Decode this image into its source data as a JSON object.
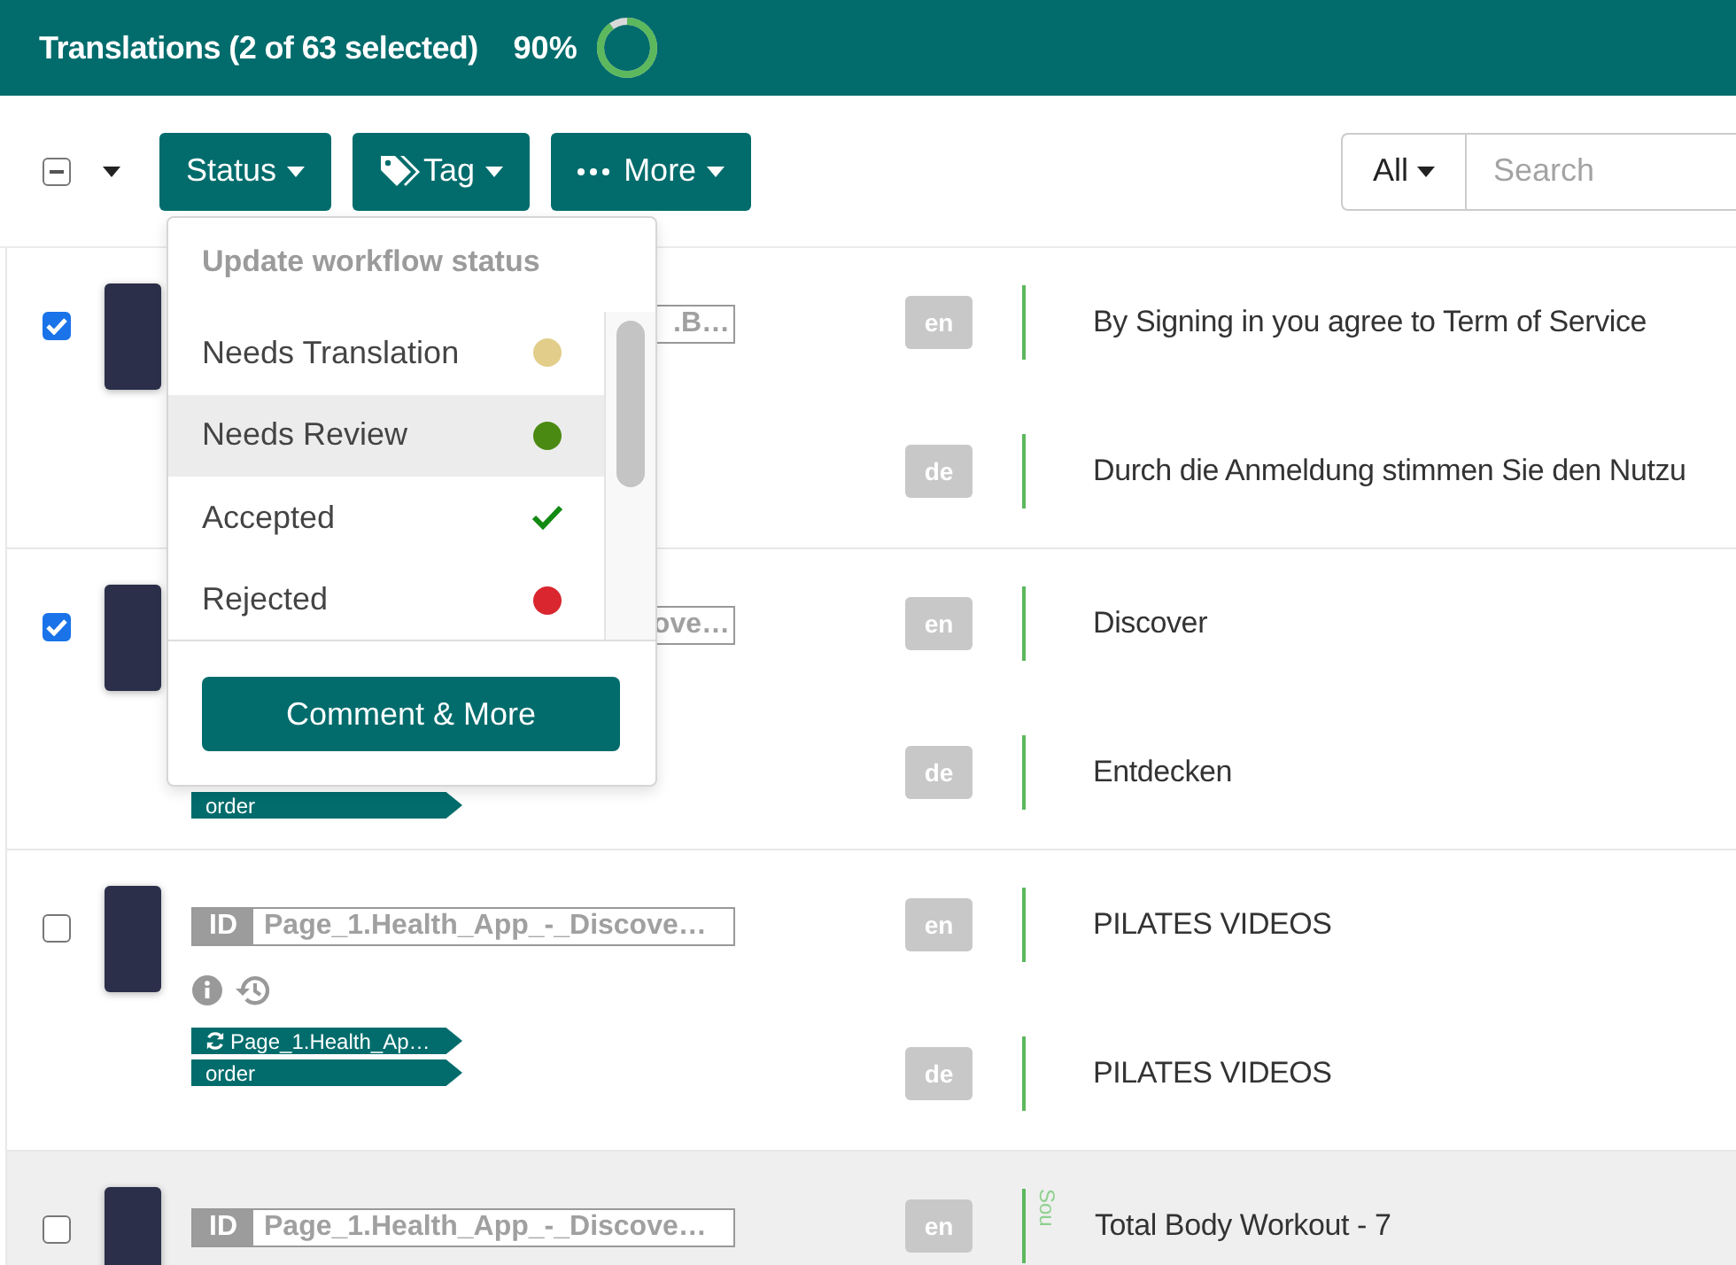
{
  "header": {
    "title": "Translations (2 of 63 selected)",
    "percent": "90%",
    "progress": {
      "level": 0.9
    }
  },
  "toolbar": {
    "select_all": {
      "indeterminate": true
    },
    "buttons": [
      {
        "label": "Status",
        "kind": "plain"
      },
      {
        "label": "Tag",
        "kind": "tag"
      },
      {
        "label": "More",
        "kind": "dots"
      }
    ],
    "scope": "All",
    "search": {
      "placeholder": "Search"
    }
  },
  "status_menu": {
    "title": "Update workflow status",
    "items": [
      {
        "label": "Needs Translation",
        "kind": "dot",
        "color": "#e2cd8a",
        "highlighted": false
      },
      {
        "label": "Needs Review",
        "kind": "dot",
        "color": "#4b8a12",
        "highlighted": true
      },
      {
        "label": "Accepted",
        "kind": "check",
        "highlighted": false
      },
      {
        "label": "Rejected",
        "kind": "dot",
        "color": "#d9262f",
        "highlighted": false
      }
    ],
    "action": "Comment & More"
  },
  "rows": [
    {
      "checked": true,
      "hovered": false,
      "id_text": ".B…",
      "tags": [],
      "icons": false,
      "translations": [
        {
          "lang": "en",
          "text": "By Signing in you agree to Term of Service"
        },
        {
          "lang": "de",
          "text": "Durch die Anmeldung stimmen Sie den Nutzu"
        }
      ]
    },
    {
      "checked": true,
      "hovered": false,
      "id_text": "ove…",
      "tags": [
        {
          "text": "order",
          "kind": "plain"
        }
      ],
      "icons": false,
      "translations": [
        {
          "lang": "en",
          "text": "Discover"
        },
        {
          "lang": "de",
          "text": "Entdecken"
        }
      ]
    },
    {
      "checked": false,
      "hovered": false,
      "id_label": "ID",
      "id_text": "Page_1.Health_App_-_Discove…",
      "icons": true,
      "tags": [
        {
          "text": "Page_1.Health_Ap…",
          "kind": "sync"
        },
        {
          "text": "order",
          "kind": "plain"
        }
      ],
      "translations": [
        {
          "lang": "en",
          "text": "PILATES VIDEOS"
        },
        {
          "lang": "de",
          "text": "PILATES VIDEOS"
        }
      ]
    },
    {
      "checked": false,
      "hovered": true,
      "id_label": "ID",
      "id_text": "Page_1.Health_App_-_Discove…",
      "icons": false,
      "tags": [],
      "translations": [
        {
          "lang": "en",
          "text": "Total Body Workout - 7",
          "source_label": "Sou"
        }
      ]
    }
  ]
}
